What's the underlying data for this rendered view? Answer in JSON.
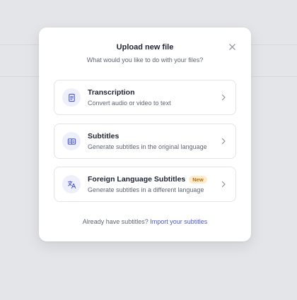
{
  "modal": {
    "title": "Upload new file",
    "subtitle": "What would you like to do with your files?",
    "close_icon": "close-icon",
    "options": [
      {
        "icon": "document-icon",
        "title": "Transcription",
        "description": "Convert audio or video to text"
      },
      {
        "icon": "subtitles-icon",
        "title": "Subtitles",
        "description": "Generate subtitles in the original language"
      },
      {
        "icon": "translate-icon",
        "title": "Foreign Language Subtitles",
        "badge": "New",
        "description": "Generate subtitles in a different language"
      }
    ],
    "footer": {
      "text": "Already have subtitles?",
      "link": "Import your subtitles"
    }
  },
  "colors": {
    "accent": "#4a56d6",
    "icon_bg": "#edf0fb",
    "badge_bg": "#fdeccc",
    "badge_text": "#b36b12",
    "overlay": "#e4e5e8"
  }
}
